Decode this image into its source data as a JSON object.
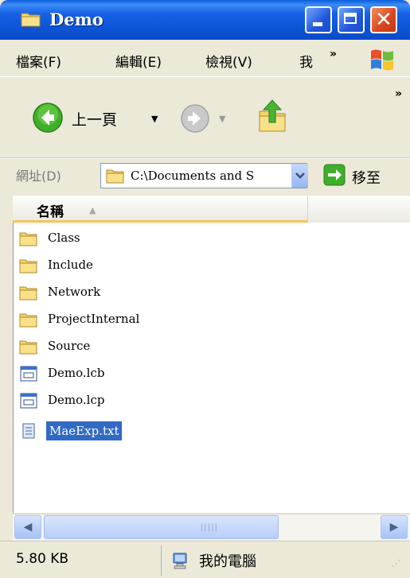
{
  "window": {
    "title": "Demo"
  },
  "menu": {
    "items": [
      "檔案(F)",
      "編輯(E)",
      "檢視(V)",
      "我"
    ],
    "overflow": "»"
  },
  "toolbar": {
    "back_label": "上一頁",
    "overflow": "»"
  },
  "address": {
    "label": "網址(D)",
    "value": "C:\\Documents and S",
    "go_label": "移至"
  },
  "columns": {
    "name_header": "名稱"
  },
  "files": [
    {
      "name": "Class",
      "type": "folder"
    },
    {
      "name": "Include",
      "type": "folder"
    },
    {
      "name": "Network",
      "type": "folder"
    },
    {
      "name": "ProjectInternal",
      "type": "folder"
    },
    {
      "name": "Source",
      "type": "folder"
    },
    {
      "name": "Demo.lcb",
      "type": "app-file"
    },
    {
      "name": "Demo.lcp",
      "type": "app-file"
    },
    {
      "name": "MaeExp.txt",
      "type": "text-file",
      "selected": true
    }
  ],
  "status": {
    "size_text": "5.80 KB",
    "location": "我的電腦"
  },
  "colors": {
    "titlebar": "#0c55d7",
    "selection": "#316ac5",
    "close_button": "#d9441d"
  }
}
